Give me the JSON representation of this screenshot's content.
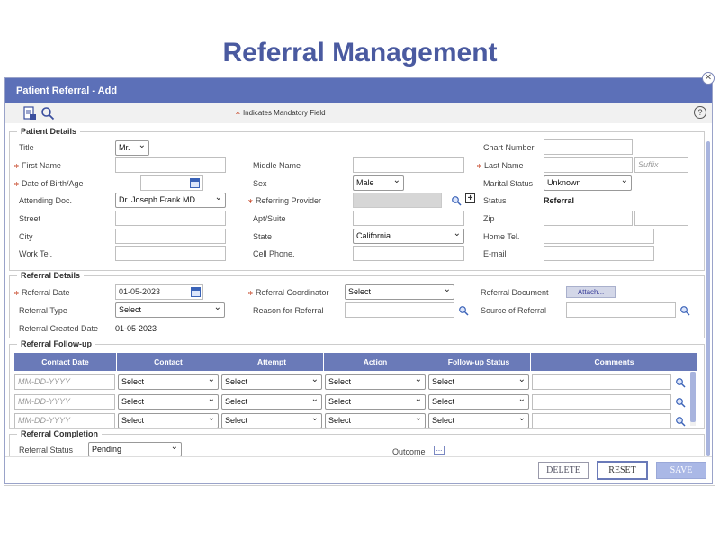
{
  "page_title": "Referral Management",
  "dialog": {
    "title": "Patient Referral - Add",
    "mandatory_note": "Indicates Mandatory Field",
    "close_icon": "close-icon",
    "help_icon_text": "?"
  },
  "patient_details": {
    "legend": "Patient Details",
    "title_label": "Title",
    "title_value": "Mr.",
    "chart_number_label": "Chart Number",
    "first_name_label": "First Name",
    "middle_name_label": "Middle Name",
    "last_name_label": "Last Name",
    "suffix_placeholder": "Suffix",
    "dob_label": "Date of Birth/Age",
    "sex_label": "Sex",
    "sex_value": "Male",
    "marital_label": "Marital Status",
    "marital_value": "Unknown",
    "attending_label": "Attending Doc.",
    "attending_value": "Dr. Joseph Frank MD",
    "referring_label": "Referring Provider",
    "status_label": "Status",
    "status_value": "Referral",
    "street_label": "Street",
    "apt_label": "Apt/Suite",
    "zip_label": "Zip",
    "city_label": "City",
    "state_label": "State",
    "state_value": "California",
    "home_tel_label": "Home Tel.",
    "work_tel_label": "Work Tel.",
    "cell_label": "Cell Phone.",
    "email_label": "E-mail"
  },
  "referral_details": {
    "legend": "Referral Details",
    "date_label": "Referral Date",
    "date_value": "01-05-2023",
    "coordinator_label": "Referral Coordinator",
    "coordinator_value": "Select",
    "document_label": "Referral Document",
    "attach_label": "Attach...",
    "type_label": "Referral Type",
    "type_value": "Select",
    "reason_label": "Reason for Referral",
    "source_label": "Source of Referral",
    "created_label": "Referral Created Date",
    "created_value": "01-05-2023"
  },
  "followup": {
    "legend": "Referral Follow-up",
    "columns": [
      "Contact Date",
      "Contact",
      "Attempt",
      "Action",
      "Follow-up Status",
      "Comments"
    ],
    "date_placeholder": "MM-DD-YYYY",
    "select_value": "Select"
  },
  "completion": {
    "legend": "Referral Completion",
    "status_label": "Referral Status",
    "status_value": "Pending",
    "outcome_label": "Outcome"
  },
  "footer": {
    "delete_label": "DELETE",
    "reset_label": "RESET",
    "save_label": "SAVE"
  },
  "colors": {
    "header": "#5c70b8",
    "title": "#4a5aa0",
    "mandatory": "#c84a2c"
  }
}
